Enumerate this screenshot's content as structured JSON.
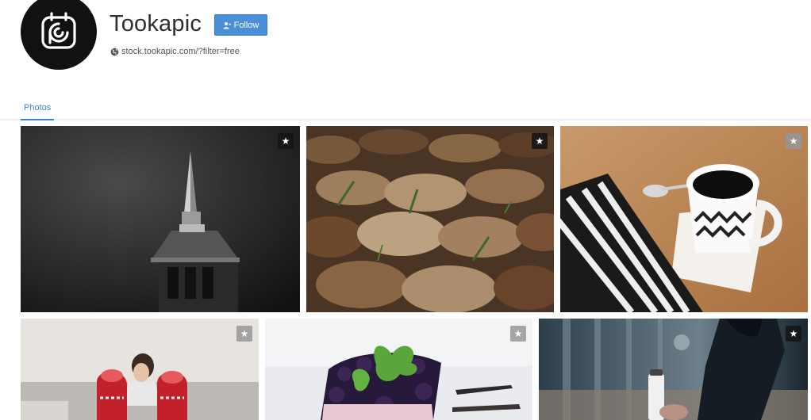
{
  "profile": {
    "name": "Tookapic",
    "follow_label": "Follow",
    "website": "stock.tookapic.com/?filter=free"
  },
  "tabs": [
    {
      "label": "Photos",
      "active": true
    }
  ],
  "colors": {
    "accent": "#4a90d9",
    "tab_active": "#3f86c9",
    "avatar_bg": "#111111"
  },
  "photos": [
    {
      "subject": "church steeple black and white",
      "star_style": "dark",
      "star_glyph": "★"
    },
    {
      "subject": "autumn oak leaves",
      "star_style": "dark",
      "star_glyph": "★"
    },
    {
      "subject": "coffee cup with striped scarf",
      "star_style": "grey",
      "star_glyph": "★"
    },
    {
      "subject": "red christmas socks",
      "star_style": "grey",
      "star_glyph": "★"
    },
    {
      "subject": "blueberry cake slice with mint",
      "star_style": "grey",
      "star_glyph": "★"
    },
    {
      "subject": "person holding thermos in park",
      "star_style": "dark",
      "star_glyph": "★"
    }
  ]
}
